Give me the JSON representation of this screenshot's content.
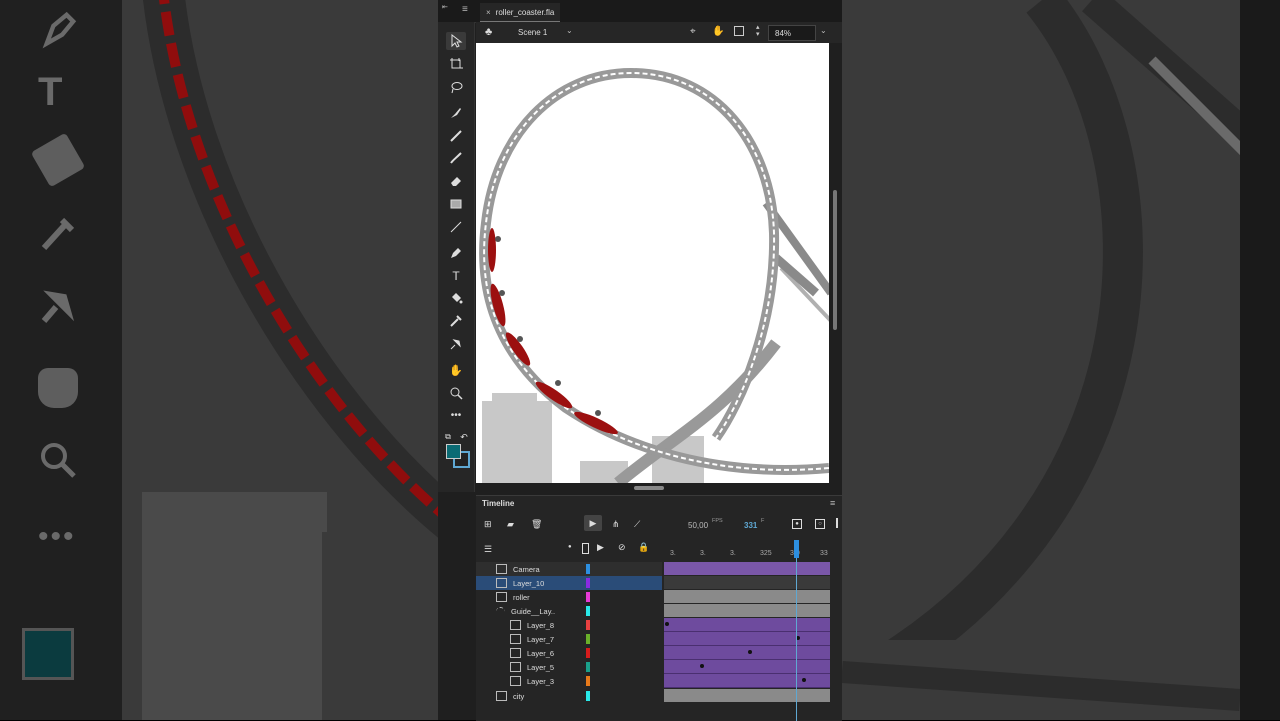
{
  "file_tab": {
    "name": "roller_coaster.fla",
    "close": "×"
  },
  "edit_bar": {
    "scene": "Scene 1",
    "zoom": "84%"
  },
  "timeline": {
    "title": "Timeline",
    "fps_value": "50,00",
    "fps_unit": "FPS",
    "frame_value": "331",
    "frame_unit": "F",
    "ruler": [
      "3.",
      "3.",
      "3.",
      "325",
      "3.0",
      "33"
    ],
    "layers": [
      {
        "name": "Camera",
        "color": "#2d8fe0",
        "type": "camera",
        "indent": 0
      },
      {
        "name": "Layer_10",
        "color": "#8a2be2",
        "type": "layer",
        "indent": 0,
        "selected": true
      },
      {
        "name": "roller",
        "color": "#e83ad6",
        "type": "layer",
        "indent": 0
      },
      {
        "name": "Guide__Lay..",
        "color": "#29e8e8",
        "type": "guide",
        "indent": 0
      },
      {
        "name": "Layer_8",
        "color": "#e84040",
        "type": "layer",
        "indent": 1
      },
      {
        "name": "Layer_7",
        "color": "#6ab02a",
        "type": "layer",
        "indent": 1
      },
      {
        "name": "Layer_6",
        "color": "#d61c1c",
        "type": "layer",
        "indent": 1
      },
      {
        "name": "Layer_5",
        "color": "#1aa08a",
        "type": "layer",
        "indent": 1
      },
      {
        "name": "Layer_3",
        "color": "#e87a1a",
        "type": "layer",
        "indent": 1
      },
      {
        "name": "city",
        "color": "#29e8e8",
        "type": "layer",
        "indent": 0
      }
    ]
  },
  "colors": {
    "stroke": "#5fa8d3",
    "fill": "#0b6b74",
    "accent": "#2d8fe0",
    "tween": "#6e4b9e"
  }
}
